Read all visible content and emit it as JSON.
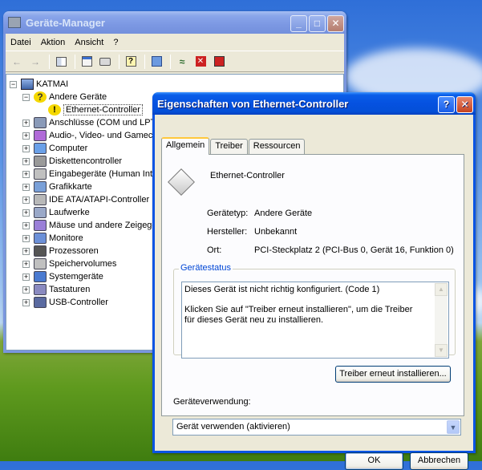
{
  "colors": {
    "xp_blue": "#0a54e3",
    "face": "#ece9d8",
    "group_title": "#0046d5",
    "warning_yellow": "#f5d800"
  },
  "device_manager": {
    "title": "Geräte-Manager",
    "menu": [
      "Datei",
      "Aktion",
      "Ansicht",
      "?"
    ],
    "toolbar_icons": [
      "back-arrow-icon",
      "forward-arrow-icon",
      "tree-view-icon",
      "properties-icon",
      "print-icon",
      "help-icon",
      "scan-hardware-icon",
      "update-driver-icon",
      "disable-device-icon",
      "uninstall-device-icon"
    ],
    "tree": {
      "root": "KATMAI",
      "items": [
        {
          "label": "Andere Geräte",
          "expanded": true,
          "icon": "unknown-device-icon",
          "children": [
            {
              "label": "Ethernet-Controller",
              "icon": "warning-device-icon"
            }
          ]
        },
        {
          "label": "Anschlüsse (COM und LPT)",
          "icon": "port-icon"
        },
        {
          "label": "Audio-, Video- und Gamecontroller",
          "icon": "audio-icon"
        },
        {
          "label": "Computer",
          "icon": "computer-icon"
        },
        {
          "label": "Diskettencontroller",
          "icon": "floppy-controller-icon"
        },
        {
          "label": "Eingabegeräte (Human Interface Devices)",
          "icon": "hid-icon"
        },
        {
          "label": "Grafikkarte",
          "icon": "display-adapter-icon"
        },
        {
          "label": "IDE ATA/ATAPI-Controller",
          "icon": "ide-icon"
        },
        {
          "label": "Laufwerke",
          "icon": "disk-drive-icon"
        },
        {
          "label": "Mäuse und andere Zeigegeräte",
          "icon": "mouse-icon"
        },
        {
          "label": "Monitore",
          "icon": "monitor-icon"
        },
        {
          "label": "Prozessoren",
          "icon": "processor-icon"
        },
        {
          "label": "Speichervolumes",
          "icon": "storage-volume-icon"
        },
        {
          "label": "Systemgeräte",
          "icon": "system-device-icon"
        },
        {
          "label": "Tastaturen",
          "icon": "keyboard-icon"
        },
        {
          "label": "USB-Controller",
          "icon": "usb-icon"
        }
      ]
    }
  },
  "dialog": {
    "title": "Eigenschaften von Ethernet-Controller",
    "tabs": [
      "Allgemein",
      "Treiber",
      "Ressourcen"
    ],
    "device_name": "Ethernet-Controller",
    "props": {
      "type_label": "Gerätetyp:",
      "type_value": "Andere Geräte",
      "mfr_label": "Hersteller:",
      "mfr_value": "Unbekannt",
      "loc_label": "Ort:",
      "loc_value": "PCI-Steckplatz 2 (PCI-Bus 0, Gerät 16, Funktion 0)"
    },
    "status_group": "Gerätestatus",
    "status_line1": "Dieses Gerät ist nicht richtig konfiguriert. (Code 1)",
    "status_line2": "Klicken Sie auf \"Treiber erneut installieren\", um die Treiber für dieses Gerät neu zu installieren.",
    "reinstall_button": "Treiber erneut installieren...",
    "usage_label": "Geräteverwendung:",
    "usage_value": "Gerät verwenden (aktivieren)",
    "ok": "OK",
    "cancel": "Abbrechen"
  }
}
